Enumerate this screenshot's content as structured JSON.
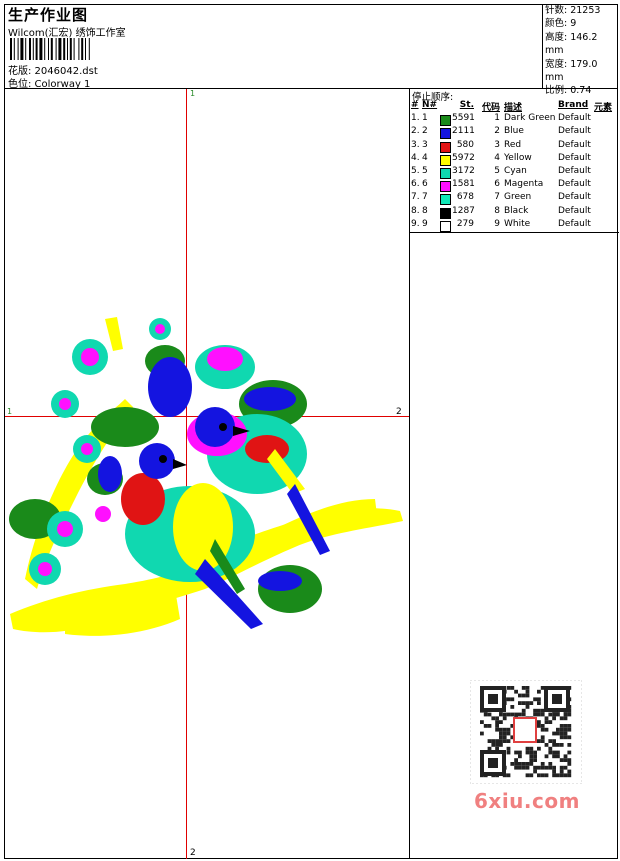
{
  "header": {
    "title": "生产作业图",
    "subtitle": "Wilcom(汇宏) 绣饰工作室",
    "file": "花版: 2046042.dst",
    "colorway": "色位: Colorway 1"
  },
  "stats": {
    "stitches": "针数: 21253",
    "colors": "颜色: 9",
    "height": "高度: 146.2 mm",
    "width": "宽度: 179.0 mm",
    "scale": "比例: 0.74"
  },
  "stop_sequence": {
    "label": "停止顺序:",
    "headers": {
      "num": "#",
      "n": "N#",
      "st": "St.",
      "code": "代码",
      "desc": "描述",
      "brand": "Brand",
      "element": "元素"
    },
    "rows": [
      {
        "num": "1.",
        "n": "1",
        "color": "#1a8a1a",
        "st": "5591",
        "code": "1",
        "desc": "Dark Green",
        "brand": "Default"
      },
      {
        "num": "2.",
        "n": "2",
        "color": "#1414e0",
        "st": "2111",
        "code": "2",
        "desc": "Blue",
        "brand": "Default"
      },
      {
        "num": "3.",
        "n": "3",
        "color": "#e01414",
        "st": "580",
        "code": "3",
        "desc": "Red",
        "brand": "Default"
      },
      {
        "num": "4.",
        "n": "4",
        "color": "#ffff00",
        "st": "5972",
        "code": "4",
        "desc": "Yellow",
        "brand": "Default"
      },
      {
        "num": "5.",
        "n": "5",
        "color": "#10d8b0",
        "st": "3172",
        "code": "5",
        "desc": "Cyan",
        "brand": "Default"
      },
      {
        "num": "6.",
        "n": "6",
        "color": "#ff10ff",
        "st": "1581",
        "code": "6",
        "desc": "Magenta",
        "brand": "Default"
      },
      {
        "num": "7.",
        "n": "7",
        "color": "#10e8b8",
        "st": "678",
        "code": "7",
        "desc": "Green",
        "brand": "Default"
      },
      {
        "num": "8.",
        "n": "8",
        "color": "#000000",
        "st": "1287",
        "code": "8",
        "desc": "Black",
        "brand": "Default"
      },
      {
        "num": "9.",
        "n": "9",
        "color": "#ffffff",
        "st": "279",
        "code": "9",
        "desc": "White",
        "brand": "Default"
      }
    ]
  },
  "axes": {
    "top": "1",
    "bottom": "2",
    "left": "1",
    "right": "2"
  },
  "watermark": "6xiu.com"
}
